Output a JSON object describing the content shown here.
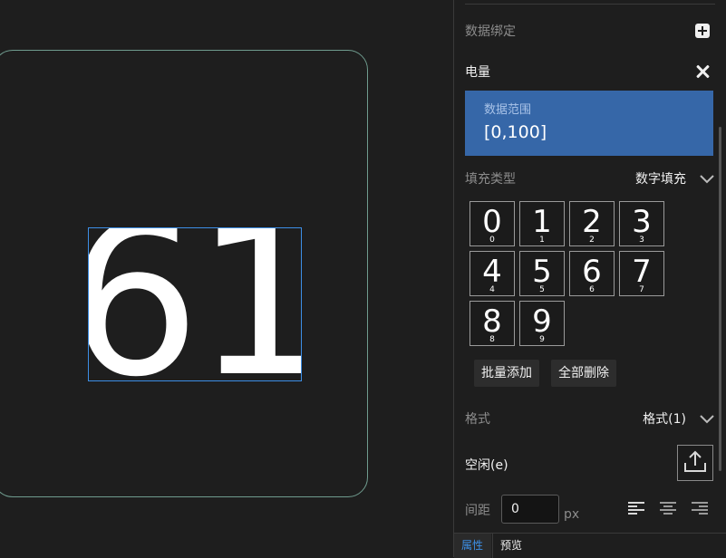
{
  "canvas": {
    "display_value": "61"
  },
  "panel": {
    "data_binding_label": "数据绑定",
    "binding": {
      "name": "电量",
      "range_title": "数据范围",
      "range_value": "[0,100]"
    },
    "fill_type": {
      "label": "填充类型",
      "value": "数字填充"
    },
    "digit_tiles": [
      {
        "glyph": "0",
        "caption": "0"
      },
      {
        "glyph": "1",
        "caption": "1"
      },
      {
        "glyph": "2",
        "caption": "2"
      },
      {
        "glyph": "3",
        "caption": "3"
      },
      {
        "glyph": "4",
        "caption": "4"
      },
      {
        "glyph": "5",
        "caption": "5"
      },
      {
        "glyph": "6",
        "caption": "6"
      },
      {
        "glyph": "7",
        "caption": "7"
      },
      {
        "glyph": "8",
        "caption": "8"
      },
      {
        "glyph": "9",
        "caption": "9"
      }
    ],
    "batch_add_label": "批量添加",
    "delete_all_label": "全部删除",
    "format": {
      "label": "格式",
      "value": "格式(1)"
    },
    "idle_label": "空闲(e)",
    "spacing": {
      "label": "间距",
      "value": "0",
      "unit": "px"
    }
  },
  "tabs": {
    "properties": "属性",
    "preview": "预览"
  },
  "colors": {
    "accent": "#3d8fe6",
    "range_card": "#3667a8",
    "device_border": "#6f9b8e"
  },
  "icons": [
    "plus-icon",
    "close-icon",
    "chevron-down-icon",
    "upload-icon",
    "align-left-icon",
    "align-center-icon",
    "align-right-icon"
  ]
}
